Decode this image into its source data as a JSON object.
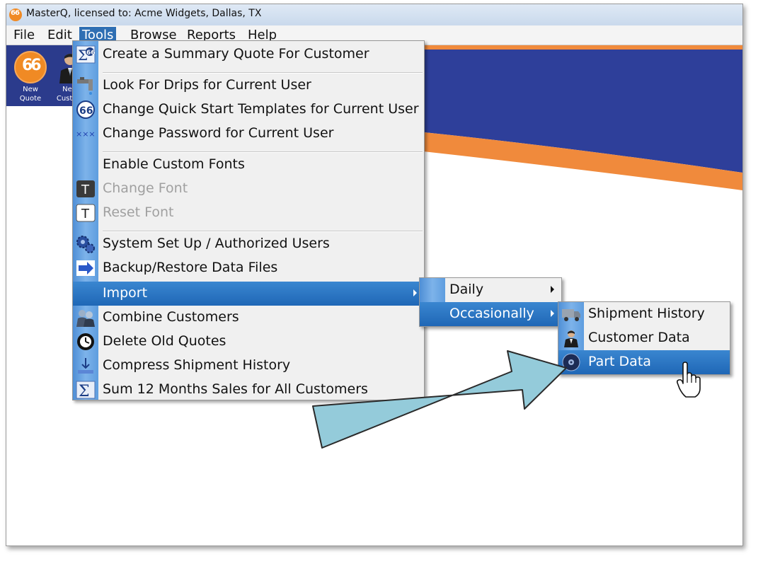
{
  "window": {
    "title": "MasterQ,  licensed to: Acme Widgets, Dallas, TX"
  },
  "menubar": [
    "File",
    "Edit",
    "Tools",
    "Browse",
    "Reports",
    "Help"
  ],
  "toolbar": {
    "new_quote": [
      "New",
      "Quote"
    ],
    "new_customer": [
      "New",
      "Custom"
    ]
  },
  "tools_menu": [
    {
      "label": "Create a Summary Quote For Customer",
      "icon": "sigma-quote-icon"
    },
    {
      "label": "Look For Drips for Current User",
      "icon": "faucet-icon"
    },
    {
      "label": "Change Quick Start Templates for Current User",
      "icon": "quote-bubble-icon"
    },
    {
      "label": "Change Password for Current User",
      "icon": "password-dots-icon"
    },
    {
      "label": "Enable Custom Fonts",
      "icon": ""
    },
    {
      "label": "Change Font",
      "icon": "font-t-dark-icon",
      "disabled": true
    },
    {
      "label": "Reset Font",
      "icon": "font-t-light-icon",
      "disabled": true
    },
    {
      "label": "System Set Up / Authorized Users",
      "icon": "gears-icon"
    },
    {
      "label": "Backup/Restore Data Files",
      "icon": "backup-arrow-icon"
    },
    {
      "label": "Import",
      "icon": "",
      "submenu": true
    },
    {
      "label": "Combine Customers",
      "icon": "customers-icon"
    },
    {
      "label": "Delete Old Quotes",
      "icon": "clock-icon"
    },
    {
      "label": "Compress Shipment History",
      "icon": "compress-icon"
    },
    {
      "label": "Sum 12 Months Sales for All Customers",
      "icon": "sigma-icon"
    }
  ],
  "import_menu": [
    {
      "label": "Daily"
    },
    {
      "label": "Occasionally"
    }
  ],
  "occasionally_menu": [
    {
      "label": "Shipment History",
      "icon": "truck-icon"
    },
    {
      "label": "Customer Data",
      "icon": "person-icon"
    },
    {
      "label": "Part Data",
      "icon": "disc-icon"
    }
  ],
  "colors": {
    "accent_highlight": "#1f67b6",
    "toolbar_navy": "#2b3b8c",
    "brand_orange": "#f08a24",
    "callout_arrow": "#94cbda"
  }
}
